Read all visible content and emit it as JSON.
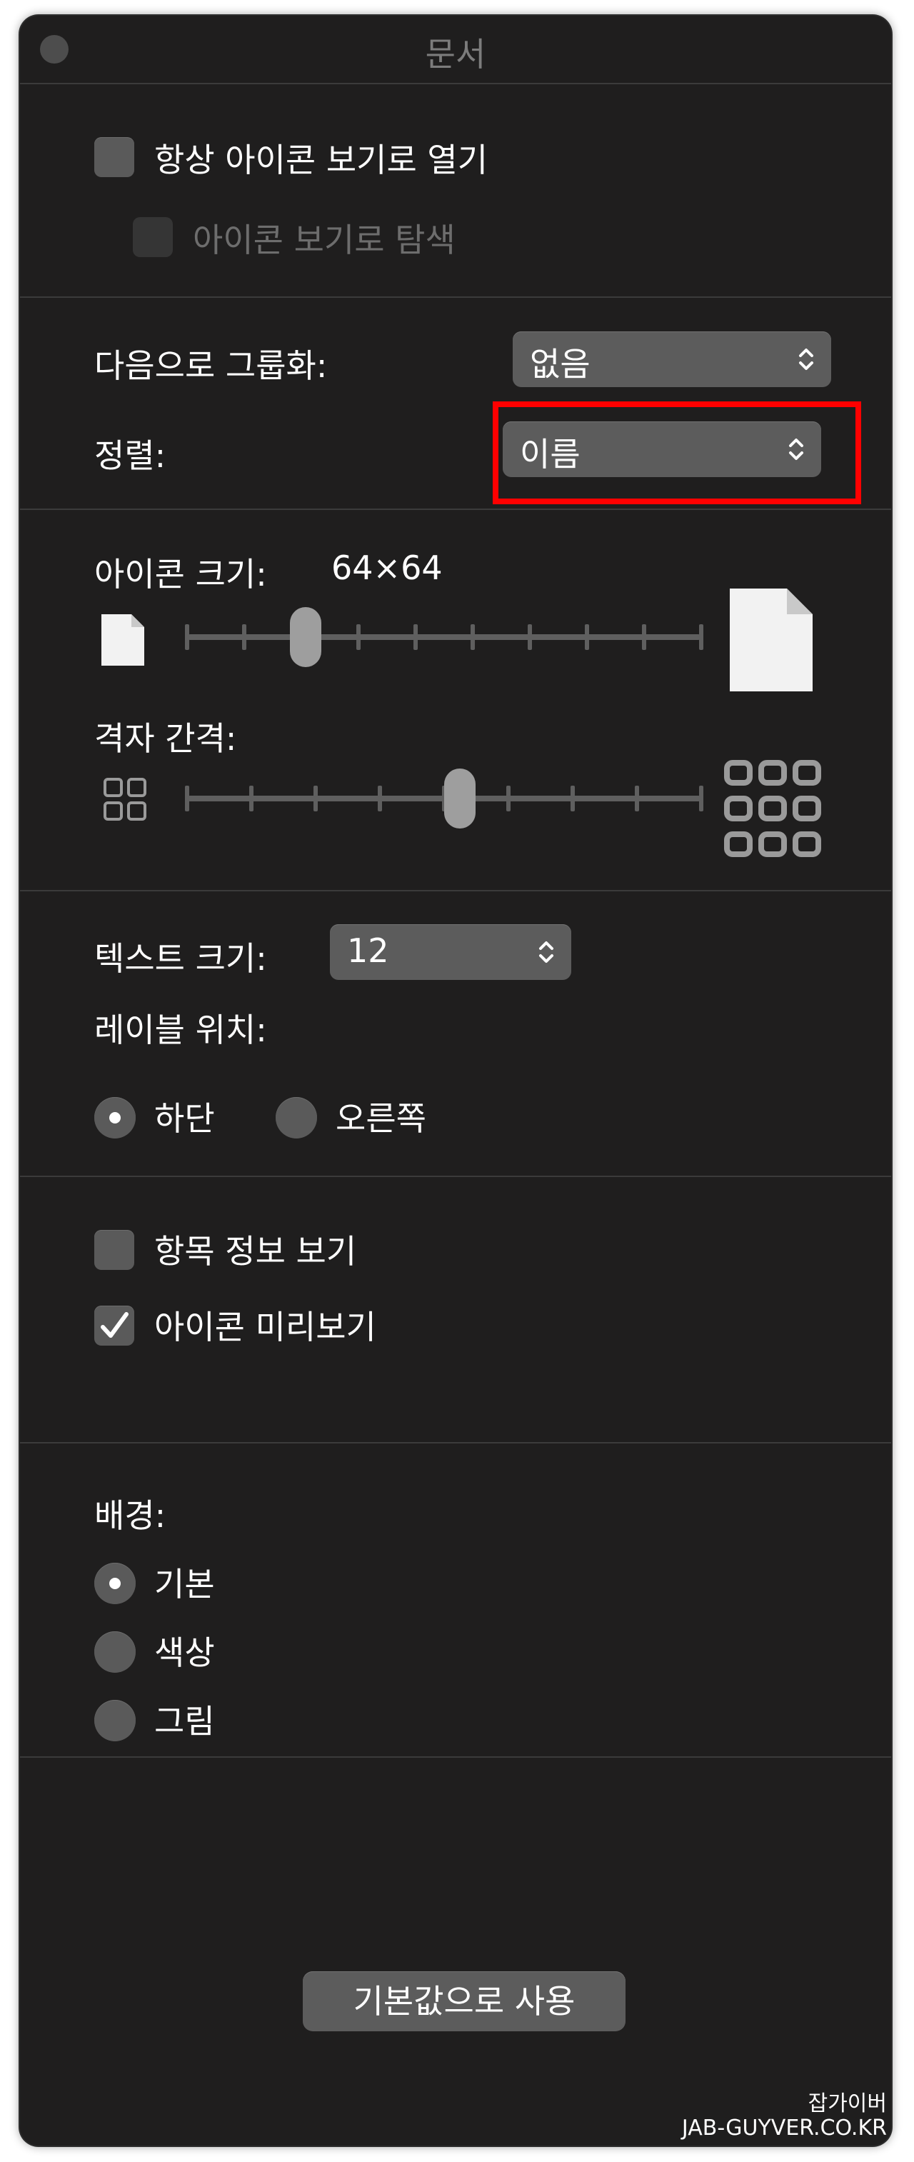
{
  "window": {
    "title": "문서"
  },
  "options": {
    "always_icon_view": {
      "label": "항상 아이콘 보기로 열기",
      "checked": false
    },
    "browse_icon_view": {
      "label": "아이콘 보기로 탐색",
      "checked": false,
      "enabled": false
    }
  },
  "grouping": {
    "label": "다음으로 그룹화:",
    "value": "없음"
  },
  "sort": {
    "label": "정렬:",
    "value": "이름"
  },
  "icon_size": {
    "label": "아이콘 크기:",
    "value": "64×64",
    "slider_level": 0.23
  },
  "grid_spacing": {
    "label": "격자 간격:",
    "slider_level": 0.53
  },
  "text_size": {
    "label": "텍스트 크기:",
    "value": "12"
  },
  "label_position": {
    "label": "레이블 위치:",
    "options": [
      {
        "label": "하단",
        "selected": true
      },
      {
        "label": "오른쪽",
        "selected": false
      }
    ]
  },
  "info": {
    "show_item_info": {
      "label": "항목 정보 보기",
      "checked": false
    },
    "icon_preview": {
      "label": "아이콘 미리보기",
      "checked": true
    }
  },
  "background": {
    "label": "배경:",
    "options": [
      {
        "label": "기본",
        "selected": true
      },
      {
        "label": "색상",
        "selected": false
      },
      {
        "label": "그림",
        "selected": false
      }
    ]
  },
  "defaults_button": {
    "label": "기본값으로 사용"
  },
  "watermark": {
    "line1": "잡가이버",
    "line2": "JAB-GUYVER.CO.KR"
  },
  "colors": {
    "window_bg": "#1f1e1e",
    "control_bg": "#5c5c5c",
    "highlight": "#ff0000"
  }
}
